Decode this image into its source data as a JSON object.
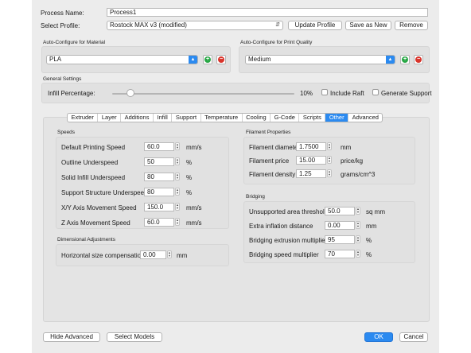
{
  "process_name": {
    "label": "Process Name:",
    "value": "Process1"
  },
  "select_profile": {
    "label": "Select Profile:",
    "value": "Rostock MAX v3 (modified)"
  },
  "profile_buttons": {
    "update": "Update Profile",
    "save_as_new": "Save as New",
    "remove": "Remove"
  },
  "material": {
    "title": "Auto-Configure for Material",
    "value": "PLA"
  },
  "quality": {
    "title": "Auto-Configure for Print Quality",
    "value": "Medium"
  },
  "general": {
    "title": "General Settings",
    "infill_label": "Infill Percentage:",
    "infill_value": "10%",
    "infill_fraction": 0.1,
    "include_raft": "Include Raft",
    "generate_support": "Generate Support"
  },
  "tabs": [
    "Extruder",
    "Layer",
    "Additions",
    "Infill",
    "Support",
    "Temperature",
    "Cooling",
    "G-Code",
    "Scripts",
    "Other",
    "Advanced"
  ],
  "active_tab": "Other",
  "speeds": {
    "title": "Speeds",
    "rows": [
      {
        "label": "Default Printing Speed",
        "value": "60.0",
        "unit": "mm/s"
      },
      {
        "label": "Outline Underspeed",
        "value": "50",
        "unit": "%"
      },
      {
        "label": "Solid Infill Underspeed",
        "value": "80",
        "unit": "%"
      },
      {
        "label": "Support Structure Underspeed",
        "value": "80",
        "unit": "%"
      },
      {
        "label": "X/Y Axis Movement Speed",
        "value": "150.0",
        "unit": "mm/s"
      },
      {
        "label": "Z Axis Movement Speed",
        "value": "60.0",
        "unit": "mm/s"
      }
    ]
  },
  "dimensional": {
    "title": "Dimensional Adjustments",
    "label": "Horizontal size compensation",
    "value": "0.00",
    "unit": "mm"
  },
  "filament": {
    "title": "Filament Properties",
    "rows": [
      {
        "label": "Filament diameter",
        "value": "1.7500",
        "unit": "mm"
      },
      {
        "label": "Filament price",
        "value": "15.00",
        "unit": "price/kg"
      },
      {
        "label": "Filament density",
        "value": "1.25",
        "unit": "grams/cm^3"
      }
    ]
  },
  "bridging": {
    "title": "Bridging",
    "rows": [
      {
        "label": "Unsupported area threshold",
        "value": "50.0",
        "unit": "sq mm"
      },
      {
        "label": "Extra inflation distance",
        "value": "0.00",
        "unit": "mm"
      },
      {
        "label": "Bridging extrusion multiplier",
        "value": "95",
        "unit": "%"
      },
      {
        "label": "Bridging speed multiplier",
        "value": "70",
        "unit": "%"
      }
    ]
  },
  "footer": {
    "hide_advanced": "Hide Advanced",
    "select_models": "Select Models",
    "ok": "OK",
    "cancel": "Cancel"
  },
  "colors": {
    "accent": "#2b8af0",
    "add": "#28a745",
    "remove": "#d9342b"
  }
}
